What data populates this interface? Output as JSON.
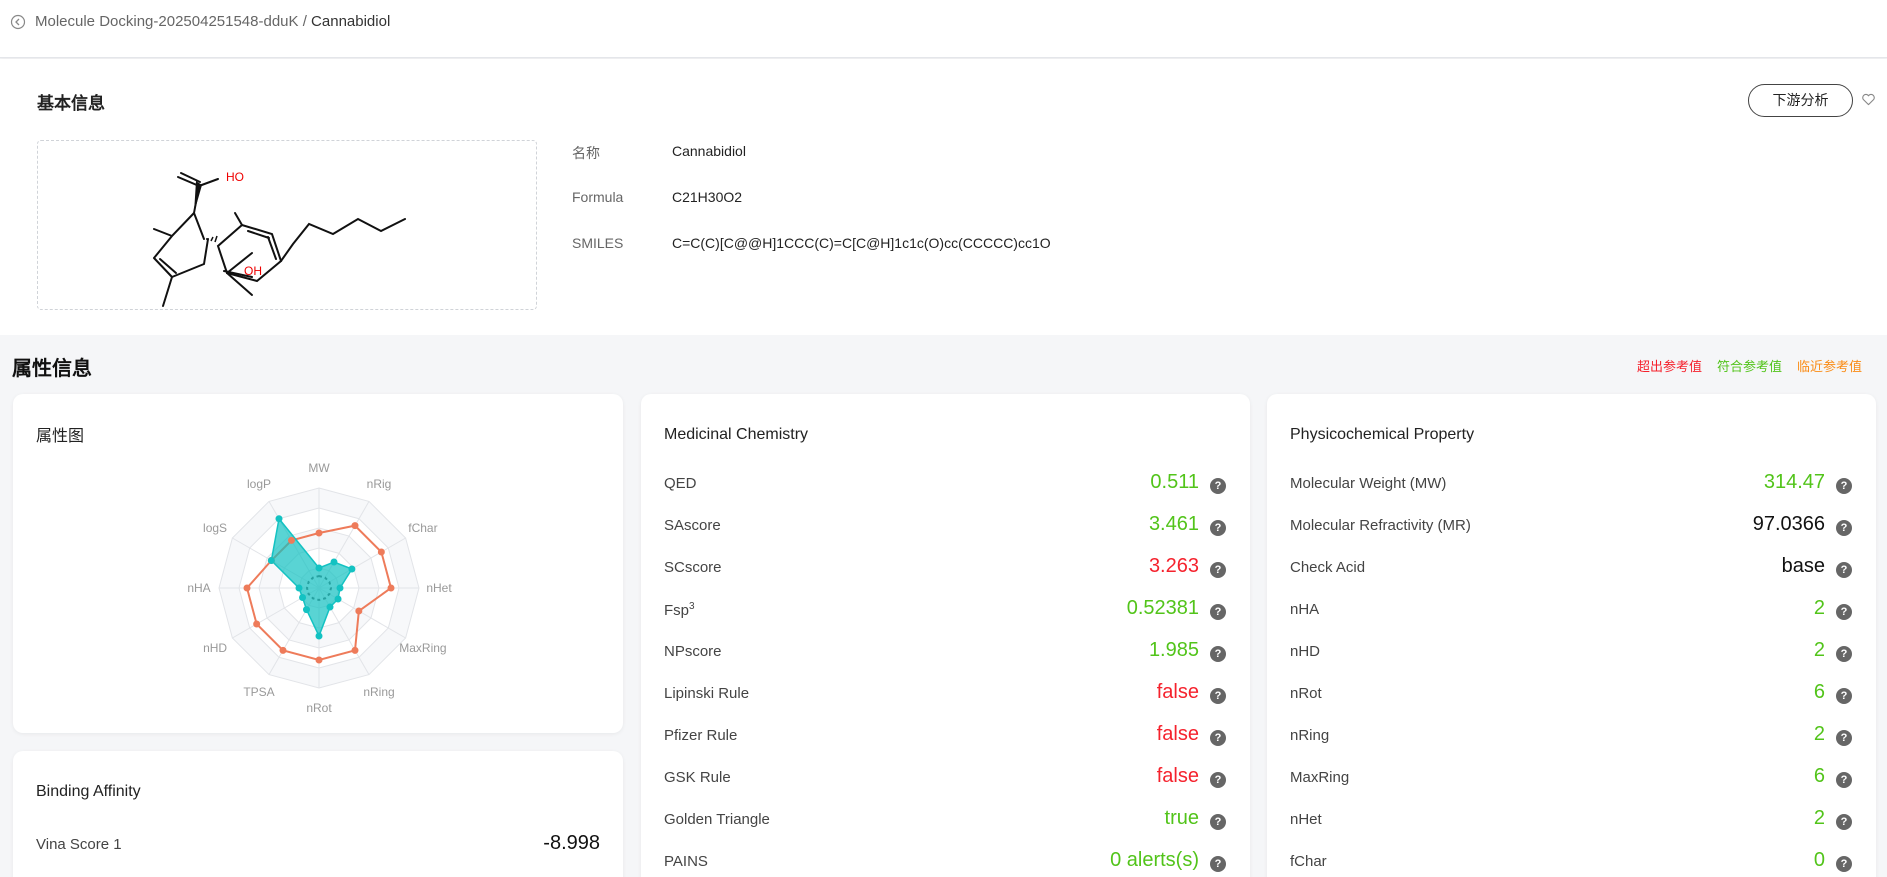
{
  "breadcrumb": {
    "parent": "Molecule Docking-202504251548-dduK",
    "separator": "/",
    "current": "Cannabidiol"
  },
  "basic": {
    "title": "基本信息",
    "downstream_button": "下游分析",
    "structure_atoms": {
      "ho": "HO",
      "oh": "OH"
    },
    "name_label": "名称",
    "name_value": "Cannabidiol",
    "formula_label": "Formula",
    "formula_value": "C21H30O2",
    "smiles_label": "SMILES",
    "smiles_value": "C=C(C)[C@@H]1CCC(C)=C[C@H]1c1c(O)cc(CCCCC)cc1O"
  },
  "properties": {
    "title": "属性信息",
    "legend": {
      "exceed": "超出参考值",
      "meet": "符合参考值",
      "near": "临近参考值"
    },
    "colors": {
      "green": "#52c41a",
      "red": "#f5222d",
      "orange": "#fa8c16",
      "teal": "#13c2c2",
      "coral": "#ee7b5a"
    }
  },
  "radar": {
    "title": "属性图",
    "axes": [
      "MW",
      "nRig",
      "fChar",
      "nHet",
      "MaxRing",
      "nRing",
      "nRot",
      "TPSA",
      "nHD",
      "nHA",
      "logS",
      "logP"
    ]
  },
  "binding": {
    "title": "Binding Affinity",
    "rows": [
      {
        "label": "Vina Score 1",
        "value": "-8.998"
      }
    ]
  },
  "medchem": {
    "title": "Medicinal Chemistry",
    "rows": [
      {
        "label": "QED",
        "value": "0.511",
        "status": "green"
      },
      {
        "label": "SAscore",
        "value": "3.461",
        "status": "green"
      },
      {
        "label": "SCscore",
        "value": "3.263",
        "status": "red"
      },
      {
        "label": "Fsp",
        "sup": "3",
        "value": "0.52381",
        "status": "green"
      },
      {
        "label": "NPscore",
        "value": "1.985",
        "status": "green"
      },
      {
        "label": "Lipinski Rule",
        "value": "false",
        "status": "red"
      },
      {
        "label": "Pfizer Rule",
        "value": "false",
        "status": "red"
      },
      {
        "label": "GSK Rule",
        "value": "false",
        "status": "red"
      },
      {
        "label": "Golden Triangle",
        "value": "true",
        "status": "green"
      },
      {
        "label": "PAINS",
        "value": "0 alerts(s)",
        "status": "green"
      }
    ]
  },
  "physchem": {
    "title": "Physicochemical Property",
    "rows": [
      {
        "label": "Molecular Weight (MW)",
        "value": "314.47",
        "status": "green"
      },
      {
        "label": "Molecular Refractivity (MR)",
        "value": "97.0366",
        "status": "black"
      },
      {
        "label": "Check Acid",
        "value": "base",
        "status": "black"
      },
      {
        "label": "nHA",
        "value": "2",
        "status": "green"
      },
      {
        "label": "nHD",
        "value": "2",
        "status": "green"
      },
      {
        "label": "nRot",
        "value": "6",
        "status": "green"
      },
      {
        "label": "nRing",
        "value": "2",
        "status": "green"
      },
      {
        "label": "MaxRing",
        "value": "6",
        "status": "green"
      },
      {
        "label": "nHet",
        "value": "2",
        "status": "green"
      },
      {
        "label": "fChar",
        "value": "0",
        "status": "green"
      }
    ]
  },
  "help_glyph": "?"
}
